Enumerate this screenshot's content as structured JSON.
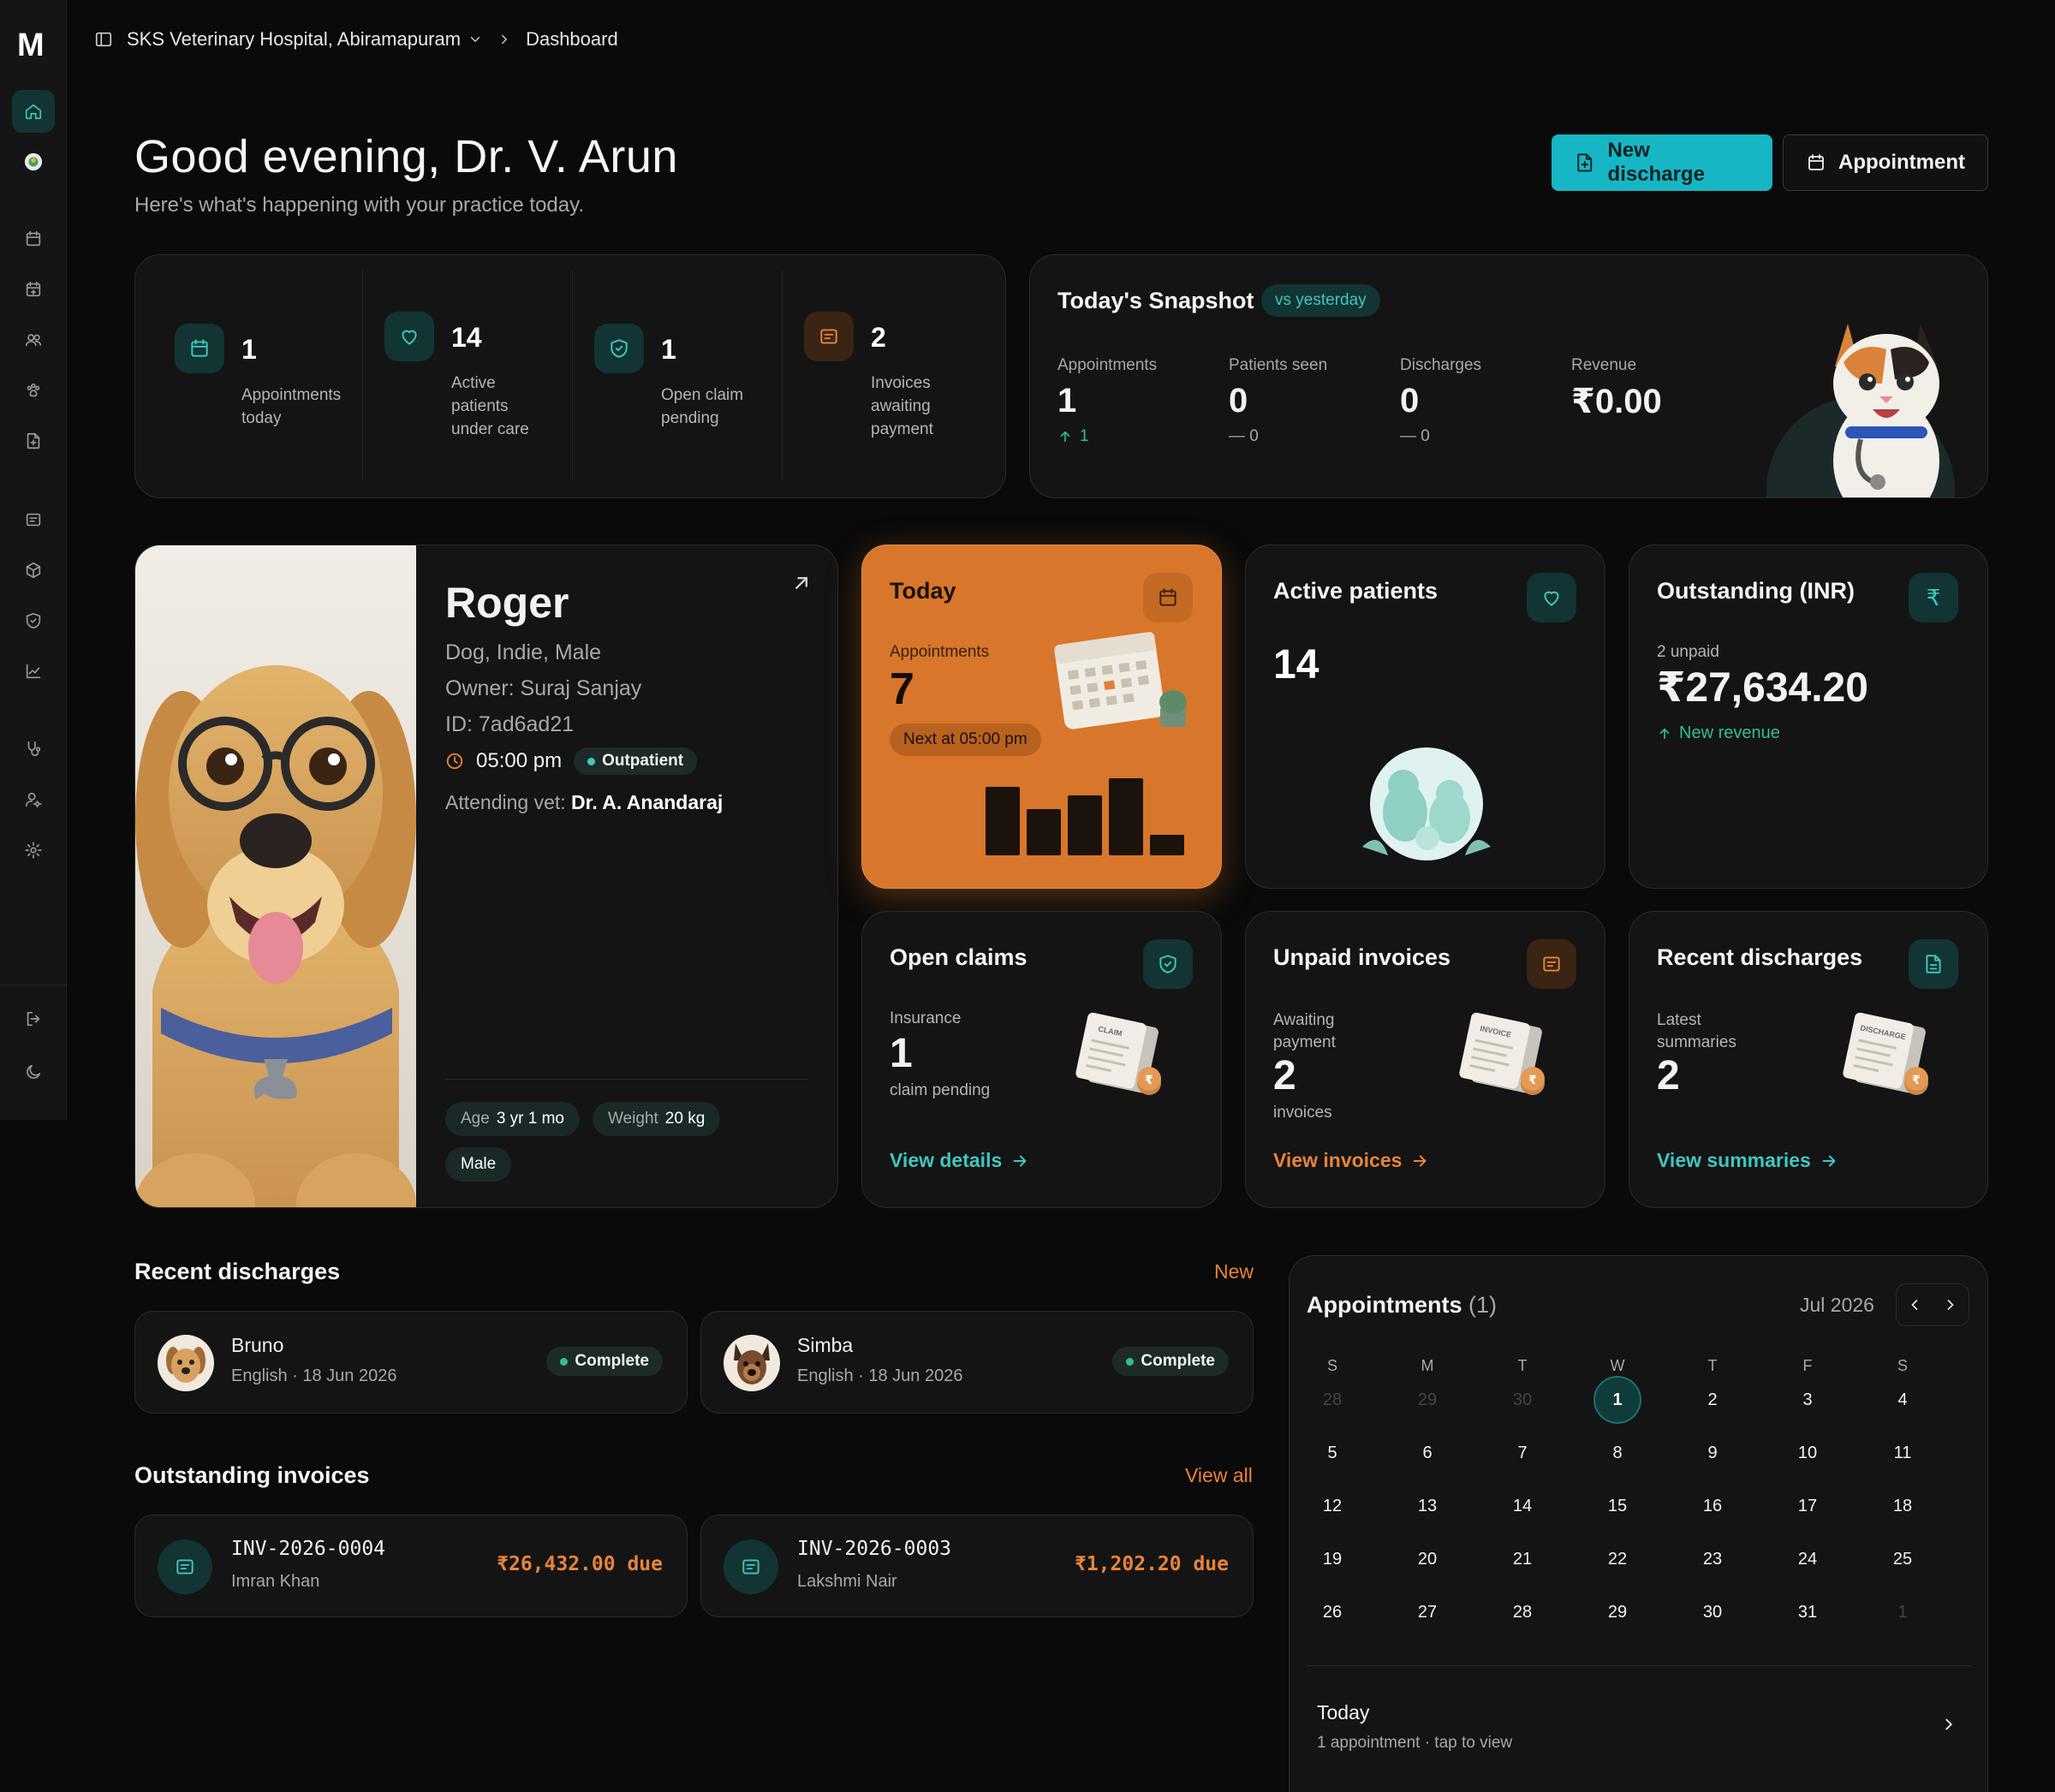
{
  "sidebar": {
    "logo": "M"
  },
  "topbar": {
    "clinic": "SKS Veterinary Hospital, Abiramapuram",
    "page": "Dashboard"
  },
  "header": {
    "greeting": "Good evening, Dr. V. Arun",
    "subtitle": "Here's what's happening with your practice today.",
    "new_discharge": "New discharge",
    "appointment": "Appointment"
  },
  "stats": [
    {
      "value": "1",
      "label": "Appointments today"
    },
    {
      "value": "14",
      "label": "Active patients under care"
    },
    {
      "value": "1",
      "label": "Open claim pending"
    },
    {
      "value": "2",
      "label": "Invoices awaiting payment"
    }
  ],
  "snapshot": {
    "title": "Today's Snapshot",
    "badge": "vs yesterday",
    "items": [
      {
        "label": "Appointments",
        "value": "1",
        "delta": "1"
      },
      {
        "label": "Patients seen",
        "value": "0",
        "delta": "— 0"
      },
      {
        "label": "Discharges",
        "value": "0",
        "delta": "— 0"
      },
      {
        "label": "Revenue",
        "value": "₹0.00",
        "delta": ""
      }
    ]
  },
  "patient": {
    "name": "Roger",
    "species": "Dog, Indie, Male",
    "owner": "Owner: Suraj Sanjay",
    "id": "ID: 7ad6ad21",
    "time": "05:00 pm",
    "type": "Outpatient",
    "vet_label": "Attending vet:",
    "vet_name": "Dr. A. Anandaraj",
    "age_label": "Age",
    "age": "3 yr 1 mo",
    "weight_label": "Weight",
    "weight": "20 kg",
    "sex": "Male"
  },
  "today_card": {
    "title": "Today",
    "label": "Appointments",
    "value": "7",
    "next": "Next at 05:00 pm"
  },
  "active_card": {
    "title": "Active patients",
    "value": "14"
  },
  "outstanding_card": {
    "title": "Outstanding (INR)",
    "sub": "2 unpaid",
    "value": "₹27,634.20",
    "trend": "New revenue"
  },
  "claims_card": {
    "title": "Open claims",
    "label": "Insurance",
    "value": "1",
    "note": "claim pending",
    "link": "View details",
    "art": "CLAIM"
  },
  "unpaid_card": {
    "title": "Unpaid invoices",
    "label": "Awaiting payment",
    "value": "2",
    "note": "invoices",
    "link": "View invoices",
    "art": "INVOICE"
  },
  "discharges_card": {
    "title": "Recent discharges",
    "label": "Latest summaries",
    "value": "2",
    "link": "View summaries",
    "art": "DISCHARGE"
  },
  "recent_discharges": {
    "title": "Recent discharges",
    "action": "New",
    "items": [
      {
        "name": "Bruno",
        "meta": "English · 18 Jun 2026",
        "status": "Complete"
      },
      {
        "name": "Simba",
        "meta": "English · 18 Jun 2026",
        "status": "Complete"
      }
    ]
  },
  "outstanding_invoices": {
    "title": "Outstanding invoices",
    "action": "View all",
    "items": [
      {
        "id": "INV-2026-0004",
        "client": "Imran Khan",
        "due": "₹26,432.00 due"
      },
      {
        "id": "INV-2026-0003",
        "client": "Lakshmi Nair",
        "due": "₹1,202.20 due"
      }
    ]
  },
  "calendar": {
    "title": "Appointments",
    "count": "(1)",
    "month": "Jul 2026",
    "weekdays": [
      "S",
      "M",
      "T",
      "W",
      "T",
      "F",
      "S"
    ],
    "weeks": [
      [
        "28",
        "29",
        "30",
        "1",
        "2",
        "3",
        "4"
      ],
      [
        "5",
        "6",
        "7",
        "8",
        "9",
        "10",
        "11"
      ],
      [
        "12",
        "13",
        "14",
        "15",
        "16",
        "17",
        "18"
      ],
      [
        "19",
        "20",
        "21",
        "22",
        "23",
        "24",
        "25"
      ],
      [
        "26",
        "27",
        "28",
        "29",
        "30",
        "31",
        "1"
      ]
    ],
    "selected": "1",
    "footer_title": "Today",
    "footer_sub": "1 appointment · tap to view"
  },
  "colors": {
    "accent_teal": "#17b6c4",
    "accent_orange": "#d8762b",
    "background": "#0a0a0a",
    "card": "#141414"
  }
}
